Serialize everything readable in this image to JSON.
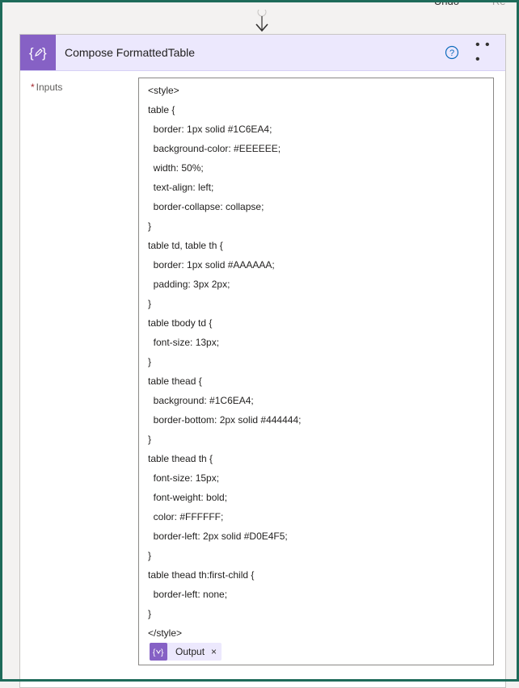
{
  "toolbar": {
    "undo_label": "Undo",
    "redo_label": "Re"
  },
  "action": {
    "title": "Compose FormattedTable",
    "icon": "compose-icon",
    "accent_color": "#8661c5",
    "header_bg": "#ece8fd"
  },
  "inputs": {
    "label": "Inputs",
    "required_marker": "*",
    "lines": [
      "<style>",
      "table {",
      "  border: 1px solid #1C6EA4;",
      "  background-color: #EEEEEE;",
      "  width: 50%;",
      "  text-align: left;",
      "  border-collapse: collapse;",
      "}",
      "table td, table th {",
      "  border: 1px solid #AAAAAA;",
      "  padding: 3px 2px;",
      "}",
      "table tbody td {",
      "  font-size: 13px;",
      "}",
      "table thead {",
      "  background: #1C6EA4;",
      "  border-bottom: 2px solid #444444;",
      "}",
      "table thead th {",
      "  font-size: 15px;",
      "  font-weight: bold;",
      "  color: #FFFFFF;",
      "  border-left: 2px solid #D0E4F5;",
      "}",
      "table thead th:first-child {",
      "  border-left: none;",
      "}",
      "</style>"
    ],
    "token": {
      "label": "Output",
      "remove": "×",
      "icon": "expression-icon"
    }
  }
}
